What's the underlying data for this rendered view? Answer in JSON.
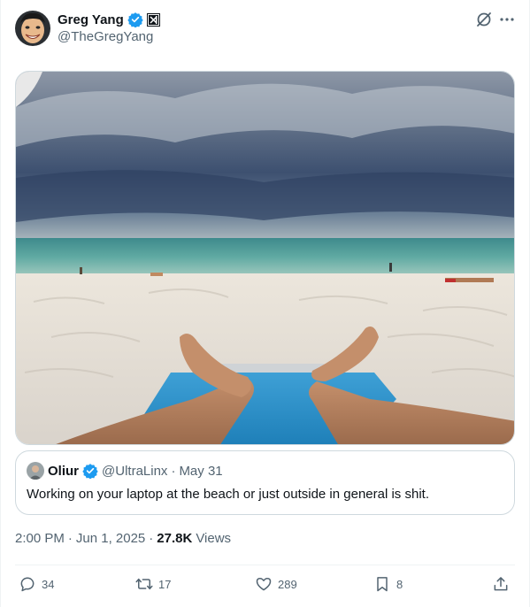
{
  "author": {
    "name": "Greg Yang",
    "handle": "@TheGregYang",
    "verified": true,
    "affiliate_badge": "xai-icon"
  },
  "header_icons": [
    "grok-icon",
    "more-icon"
  ],
  "quote": {
    "name": "Oliur",
    "handle": "@UltraLinx",
    "separator": "·",
    "date": "May 31",
    "text": "Working on your laptop at the beach or just outside in general is shit."
  },
  "meta": {
    "time": "2:00 PM",
    "dot1": "·",
    "date": "Jun 1, 2025",
    "dot2": "·",
    "views_count": "27.8K",
    "views_label": "Views"
  },
  "actions": {
    "replies": "34",
    "reposts": "17",
    "likes": "289",
    "bookmarks": "8"
  },
  "colors": {
    "verified_blue": "#1d9bf0",
    "secondary_text": "#536471",
    "border": "#cfd9de"
  }
}
